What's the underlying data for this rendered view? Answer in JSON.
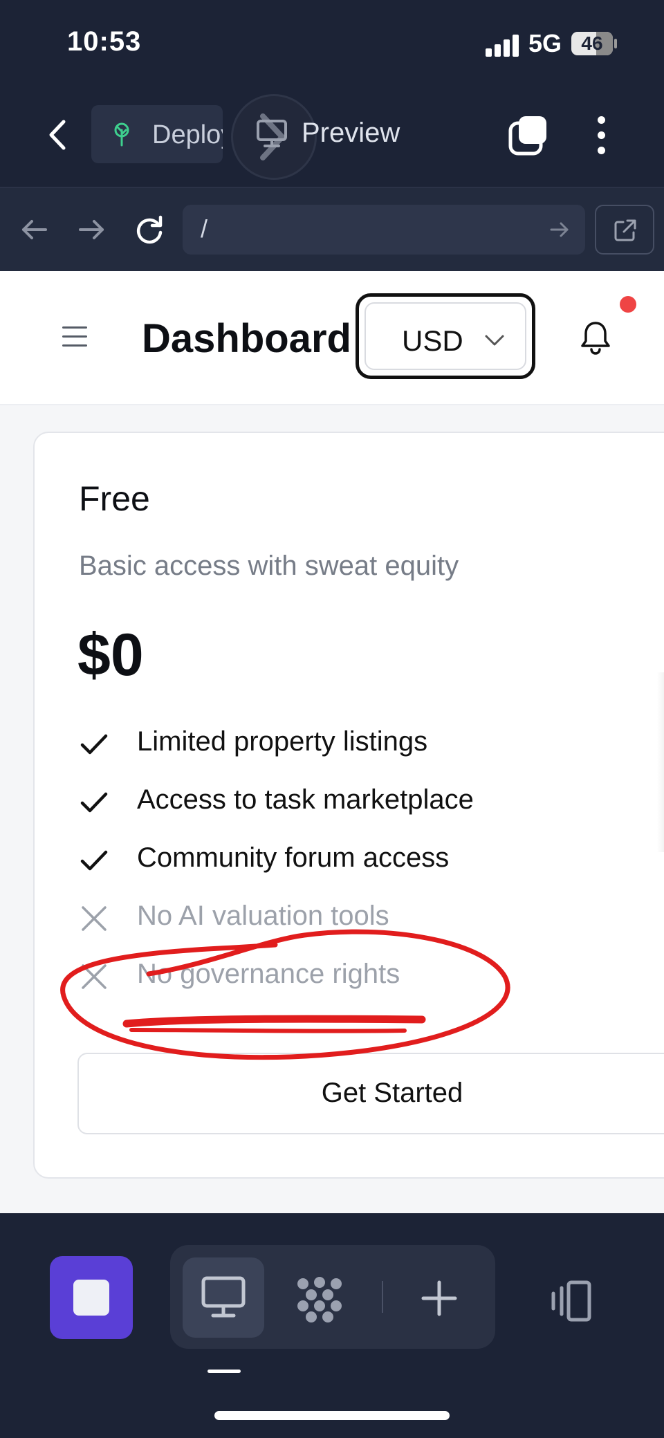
{
  "status_bar": {
    "time": "10:53",
    "network": "5G",
    "battery": "46",
    "battery_level_percent": 46
  },
  "app_bar": {
    "deploy_tab_label": "Deploy",
    "preview_label": "Preview",
    "icons": [
      "chevron-left-icon",
      "sprout-icon",
      "monitor-icon",
      "tabs-icon",
      "more-vertical-icon"
    ]
  },
  "browser": {
    "url": "/"
  },
  "page": {
    "title": "Dashboard",
    "currency": "USD",
    "has_notification": true
  },
  "plan": {
    "name": "Free",
    "description": "Basic access with sweat equity",
    "price": "$0",
    "features": [
      {
        "text": "Limited property listings",
        "included": true
      },
      {
        "text": "Access to task marketplace",
        "included": true
      },
      {
        "text": "Community forum access",
        "included": true
      },
      {
        "text": "No AI valuation tools",
        "included": false
      },
      {
        "text": "No governance rights",
        "included": false
      }
    ],
    "cta_label": "Get Started"
  },
  "annotation": {
    "color": "#e11d1d",
    "circled_feature": "No governance rights"
  },
  "colors": {
    "chrome_bg": "#1c2336",
    "accent_purple": "#5a3fd6",
    "notification_red": "#ef4444"
  }
}
